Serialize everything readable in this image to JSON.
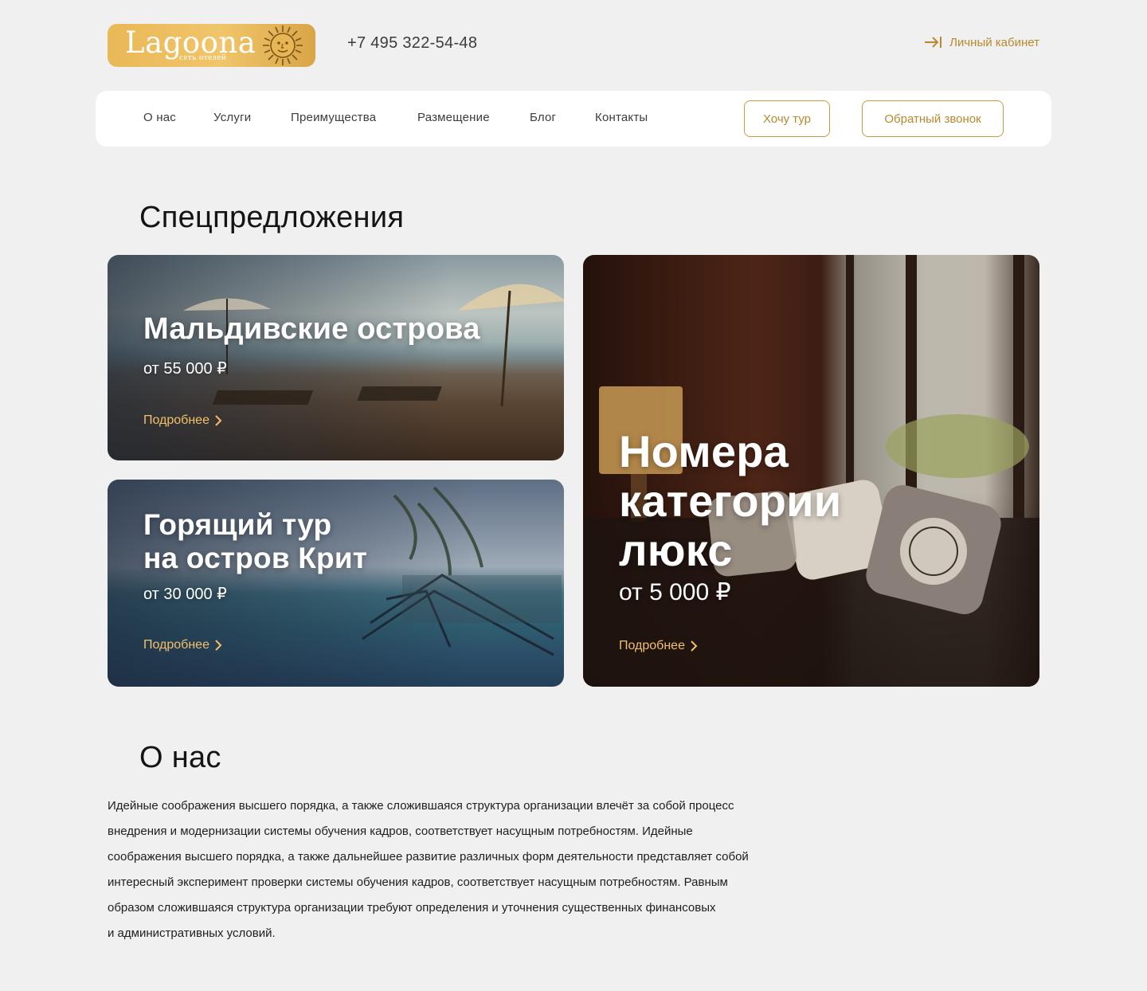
{
  "header": {
    "logo": {
      "word": "Lagoona",
      "subtitle": "сеть отелей"
    },
    "phone": "+7 495 322-54-48",
    "cabinet_label": "Личный кабинет"
  },
  "nav": {
    "items": [
      {
        "label": "О нас"
      },
      {
        "label": "Услуги"
      },
      {
        "label": "Преимущества"
      },
      {
        "label": "Размещение"
      },
      {
        "label": "Блог"
      },
      {
        "label": "Контакты"
      }
    ],
    "tour_button": "Хочу тур",
    "callback_button": "Обратный звонок"
  },
  "offers": {
    "title": "Спецпредложения",
    "cards": [
      {
        "title": "Мальдивские острова",
        "price": "от 55 000 ₽",
        "link": "Подробнее"
      },
      {
        "title_line1": "Горящий тур",
        "title_line2": "на остров Крит",
        "price": "от 30 000 ₽",
        "link": "Подробнее"
      },
      {
        "title_line1": "Номера",
        "title_line2": "категории",
        "title_line3": "люкс",
        "price": "от 5 000 ₽",
        "link": "Подробнее"
      }
    ]
  },
  "about": {
    "title": "О нас",
    "text_lines": [
      "Идейные соображения высшего порядка, а также сложившаяся структура организации влечёт за собой процесс",
      "внедрения и модернизации системы обучения кадров, соответствует насущным потребностям. Идейные",
      "соображения высшего порядка, а также дальнейшее развитие различных форм деятельности представляет собой",
      "интересный эксперимент проверки системы обучения кадров, соответствует насущным потребностям. Равным",
      "образом сложившаяся структура организации требуют определения и уточнения существенных финансовых",
      "и административных условий."
    ]
  },
  "colors": {
    "accent": "#b8892f",
    "accent_light": "#f1c06a",
    "background": "#f0f0f0",
    "logo_gold": "#edbd5f"
  }
}
